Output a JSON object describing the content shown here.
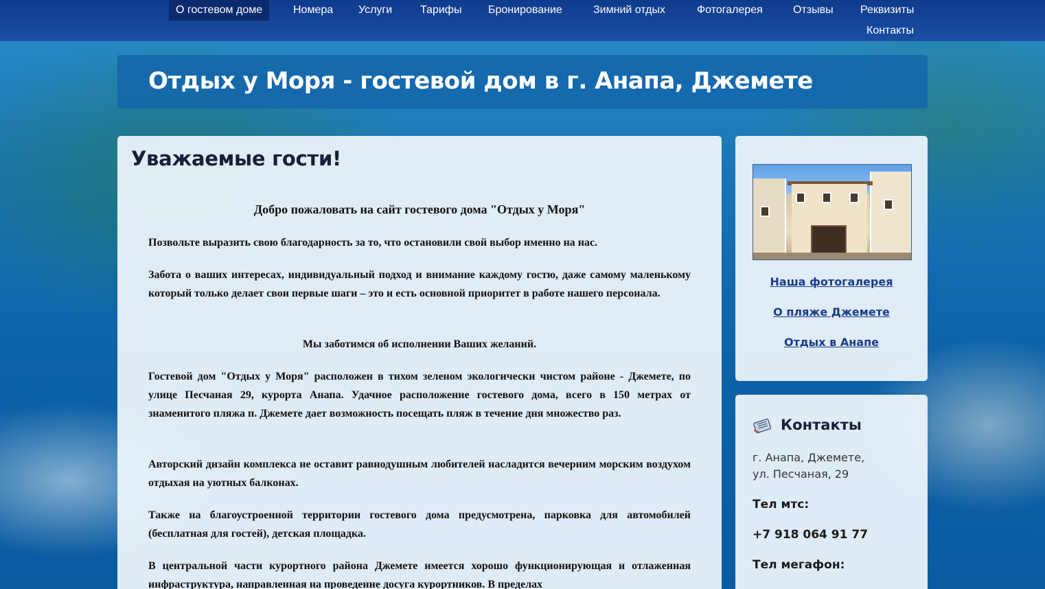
{
  "nav": {
    "items": [
      {
        "label": "О гостевом доме",
        "active": true
      },
      {
        "label": "Номера"
      },
      {
        "label": "Услуги"
      },
      {
        "label": "Тарифы"
      },
      {
        "label": "Бронирование"
      },
      {
        "label": "Зимний отдых"
      },
      {
        "label": "Фотогалерея"
      },
      {
        "label": "Отзывы"
      },
      {
        "label": "Реквизиты"
      },
      {
        "label": "Контакты"
      }
    ]
  },
  "banner": {
    "title": "Отдых у Моря - гостевой дом в г. Анапа, Джемете"
  },
  "main": {
    "heading": "Уважаемые гости!",
    "paragraphs": [
      "Добро пожаловать на сайт гостевого дома \"Отдых у Моря\"",
      "Позвольте выразить свою благодарность за то, что остановили свой выбор именно на нас.",
      "Забота о ваших интересах, индивидуальный подход и внимание каждому гостю, даже самому маленькому который только делает свои первые шаги – это и есть основной приоритет в работе нашего персонала.",
      "Мы заботимся об исполнении Ваших желаний.",
      "Гостевой дом \"Отдых у Моря\" расположен в тихом зеленом экологически чистом районе - Джемете, по улице Песчаная 29, курорта Анапа. Удачное расположение гостевого дома, всего в 150 метрах от знаменитого пляжа п. Джемете дает возможность посещать пляж в течение дня множество раз.",
      "Авторский дизайн комплекса не оставит равнодушным любителей насладится вечерним морским воздухом отдыхая на уютных балконах.",
      "Также на благоустроенной территории гостевого дома предусмотрена, парковка для автомобилей (бесплатная для гостей), детская площадка.",
      "В центральной части курортного района Джемете имеется хорошо функционирующая и отлаженная инфраструктура, направленная на проведение досуга курортников. В пределах"
    ]
  },
  "sidebar": {
    "links": [
      {
        "label": "Наша фотогалерея"
      },
      {
        "label": "О пляже Джемете"
      },
      {
        "label": "Отдых в Анапе"
      }
    ],
    "photo_icon": "guesthouse-photo"
  },
  "contacts": {
    "title": "Контакты",
    "icon": "phone-book-icon",
    "address_line1": "г. Анапа, Джемете,",
    "address_line2": "ул. Песчаная, 29",
    "mts_label": "Тел мтс:",
    "mts_phone": "+7 918 064 91 77",
    "megafon_label": "Тел мегафон:"
  },
  "colors": {
    "nav_bg": "#0f3b8c",
    "nav_active": "#0c2a6e",
    "banner_bg": "#1264aa",
    "link": "#1a3c8c"
  }
}
